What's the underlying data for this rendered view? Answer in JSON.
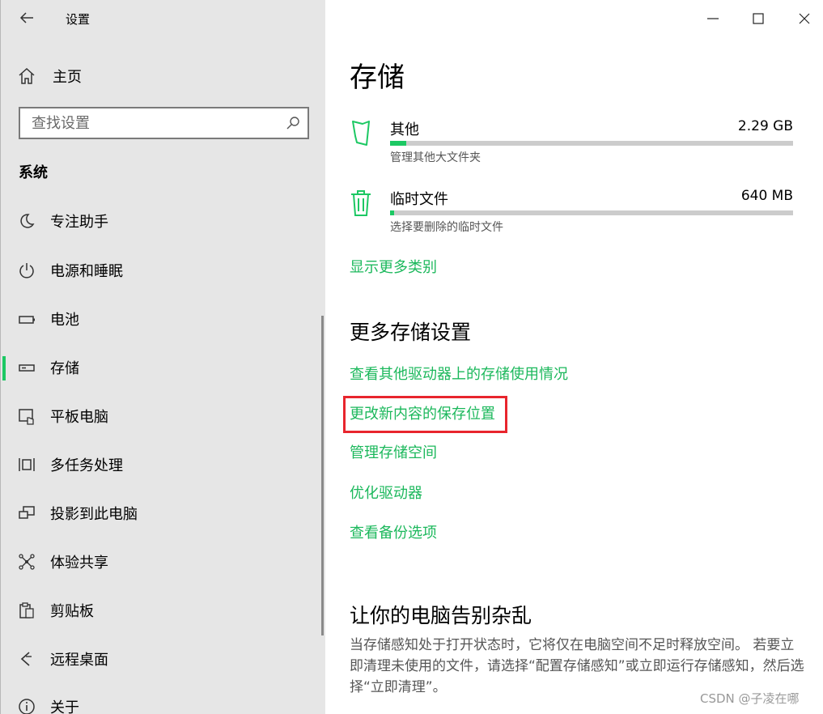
{
  "window": {
    "title": "设置"
  },
  "sidebar": {
    "home_label": "主页",
    "search_placeholder": "查找设置",
    "section_label": "系统",
    "items": [
      {
        "label": "专注助手",
        "icon": "moon-icon"
      },
      {
        "label": "电源和睡眠",
        "icon": "power-icon"
      },
      {
        "label": "电池",
        "icon": "battery-icon"
      },
      {
        "label": "存储",
        "icon": "storage-icon",
        "active": true
      },
      {
        "label": "平板电脑",
        "icon": "tablet-icon"
      },
      {
        "label": "多任务处理",
        "icon": "multitask-icon"
      },
      {
        "label": "投影到此电脑",
        "icon": "project-icon"
      },
      {
        "label": "体验共享",
        "icon": "share-icon"
      },
      {
        "label": "剪贴板",
        "icon": "clipboard-icon"
      },
      {
        "label": "远程桌面",
        "icon": "remote-desktop-icon"
      },
      {
        "label": "关于",
        "icon": "info-icon"
      }
    ]
  },
  "main": {
    "title": "存储",
    "categories": [
      {
        "name": "其他",
        "size": "2.29 GB",
        "desc": "管理其他大文件夹",
        "usage_fraction": 0.04,
        "icon": "other-folder-icon"
      },
      {
        "name": "临时文件",
        "size": "640 MB",
        "desc": "选择要删除的临时文件",
        "usage_fraction": 0.01,
        "icon": "trash-icon"
      }
    ],
    "show_more": "显示更多类别",
    "more_settings_heading": "更多存储设置",
    "links": [
      "查看其他驱动器上的存储使用情况",
      "更改新内容的保存位置",
      "管理存储空间",
      "优化驱动器",
      "查看备份选项"
    ],
    "declutter_heading": "让你的电脑告别杂乱",
    "declutter_text": "当存储感知处于打开状态时，它将仅在电脑空间不足时释放空间。 若要立即清理未使用的文件，请选择“配置存储感知”或立即运行存储感知，然后选择“立即清理”。"
  },
  "colors": {
    "accent": "#1cc863",
    "link": "#1cb85c",
    "highlight": "#e8252d",
    "sidebar_bg": "#e6e6e6"
  },
  "watermark": "CSDN @子凌在哪"
}
